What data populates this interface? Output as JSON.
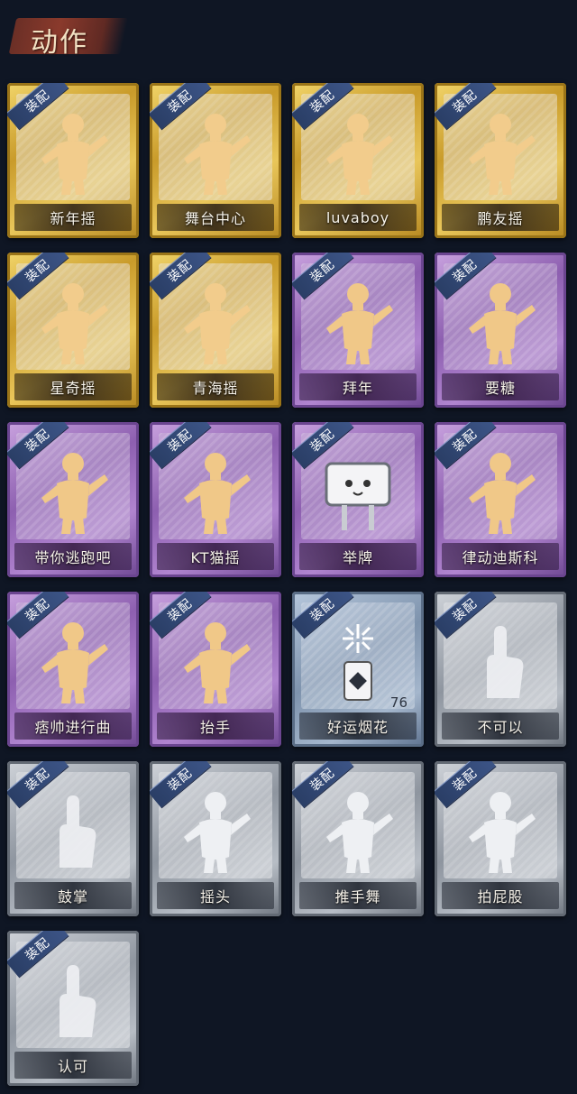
{
  "header": {
    "title": "动作"
  },
  "badge_text": "装配",
  "colors": {
    "background": "#0f1624",
    "gold": "#d9b23e",
    "purple": "#a47ac6",
    "blue": "#8fa3bd",
    "gray": "#a7adb6",
    "badge": "#34497a"
  },
  "cards": [
    {
      "label": "新年摇",
      "tier": "gold",
      "icon": "figure-icon"
    },
    {
      "label": "舞台中心",
      "tier": "gold",
      "icon": "figure-icon"
    },
    {
      "label": "luvaboy",
      "tier": "gold",
      "icon": "figure-icon"
    },
    {
      "label": "鹏友摇",
      "tier": "gold",
      "icon": "figure-icon"
    },
    {
      "label": "星奇摇",
      "tier": "gold",
      "icon": "figure-icon"
    },
    {
      "label": "青海摇",
      "tier": "gold",
      "icon": "figure-icon"
    },
    {
      "label": "拜年",
      "tier": "purple",
      "icon": "figure-icon"
    },
    {
      "label": "要糖",
      "tier": "purple",
      "icon": "figure-icon"
    },
    {
      "label": "带你逃跑吧",
      "tier": "purple",
      "icon": "figure-icon"
    },
    {
      "label": "KT猫摇",
      "tier": "purple",
      "icon": "figure-icon"
    },
    {
      "label": "举牌",
      "tier": "purple",
      "icon": "sign-icon"
    },
    {
      "label": "律动迪斯科",
      "tier": "purple",
      "icon": "figure-icon"
    },
    {
      "label": "痞帅进行曲",
      "tier": "purple",
      "icon": "figure-icon"
    },
    {
      "label": "抬手",
      "tier": "purple",
      "icon": "figure-icon"
    },
    {
      "label": "好运烟花",
      "tier": "blue",
      "icon": "firework-icon",
      "count": "76"
    },
    {
      "label": "不可以",
      "tier": "gray",
      "icon": "hand-icon"
    },
    {
      "label": "鼓掌",
      "tier": "gray",
      "icon": "hand-icon"
    },
    {
      "label": "摇头",
      "tier": "gray",
      "icon": "figure-icon"
    },
    {
      "label": "推手舞",
      "tier": "gray",
      "icon": "figure-icon"
    },
    {
      "label": "拍屁股",
      "tier": "gray",
      "icon": "figure-icon"
    },
    {
      "label": "认可",
      "tier": "gray",
      "icon": "hand-icon"
    }
  ]
}
